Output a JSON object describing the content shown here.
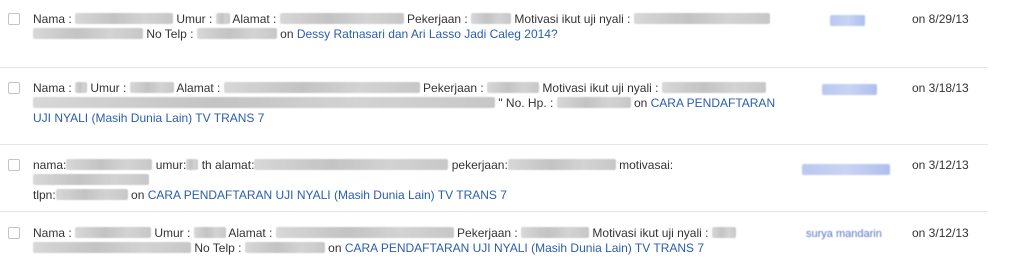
{
  "rows": [
    {
      "seg1": "Nama : ",
      "seg2": " Umur : ",
      "seg3": " Alamat : ",
      "seg4": " Pekerjaan : ",
      "seg5": " Motivasi ikut uji nyali : ",
      "seg6": " No Telp : ",
      "seg7": " on ",
      "link": "Dessy Ratnasari dan Ari Lasso Jadi Caleg 2014?",
      "author": "",
      "date": "on 8/29/13"
    },
    {
      "seg1": "Nama : ",
      "seg2": " Umur : ",
      "seg3": " Alamat : ",
      "seg4": " Pekerjaan : ",
      "seg5": " Motivasi ikut uji nyali : ",
      "seg6": " \" No. Hp. : ",
      "seg7": " on ",
      "link": "CARA PENDAFTARAN UJI NYALI (Masih Dunia Lain) TV TRANS 7",
      "author": "",
      "date": "on 3/18/13"
    },
    {
      "seg1": "nama:",
      "seg2": " umur:",
      "seg3": " th alamat:",
      "seg4": " pekerjaan:",
      "seg5": " motivasai:",
      "seg6": "tlpn:",
      "seg7": " on ",
      "link": "CARA PENDAFTARAN UJI NYALI (Masih Dunia Lain) TV TRANS 7",
      "author": "",
      "date": "on 3/12/13"
    },
    {
      "seg1": "Nama : ",
      "seg2": " Umur : ",
      "seg3": " Alamat : ",
      "seg4": " Pekerjaan : ",
      "seg5": " Motivasi ikut uji nyali : ",
      "seg6": " No Telp : ",
      "seg7": " on ",
      "link": "CARA PENDAFTARAN UJI NYALI (Masih Dunia Lain) TV TRANS 7",
      "author": "surya mandarin",
      "date": "on 3/12/13"
    }
  ]
}
